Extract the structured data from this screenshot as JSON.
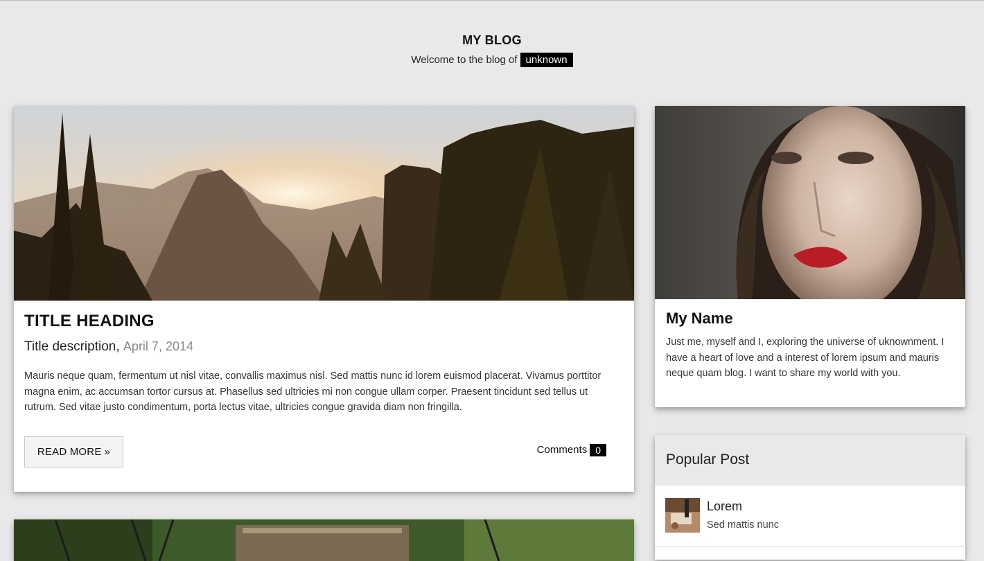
{
  "header": {
    "title": "MY BLOG",
    "welcome_text": "Welcome to the blog of",
    "user_badge": "unknown"
  },
  "post": {
    "title": "TITLE HEADING",
    "description": "Title description,",
    "date": "April 7, 2014",
    "body": "Mauris neque quam, fermentum ut nisl vitae, convallis maximus nisl. Sed mattis nunc id lorem euismod placerat. Vivamus porttitor magna enim, ac accumsan tortor cursus at. Phasellus sed ultricies mi non congue ullam corper. Praesent tincidunt sed tellus ut rutrum. Sed vitae justo condimentum, porta lectus vitae, ultricies congue gravida diam non fringilla.",
    "read_more_label": "READ MORE",
    "read_more_arrow": "»",
    "comments_label": "Comments",
    "comments_count": "0"
  },
  "profile": {
    "name": "My Name",
    "bio": "Just me, myself and I, exploring the universe of uknownment. I have a heart of love and a interest of lorem ipsum and mauris neque quam blog. I want to share my world with you."
  },
  "popular": {
    "heading": "Popular Post",
    "items": [
      {
        "name": "Lorem",
        "subtitle": "Sed mattis nunc"
      }
    ]
  }
}
